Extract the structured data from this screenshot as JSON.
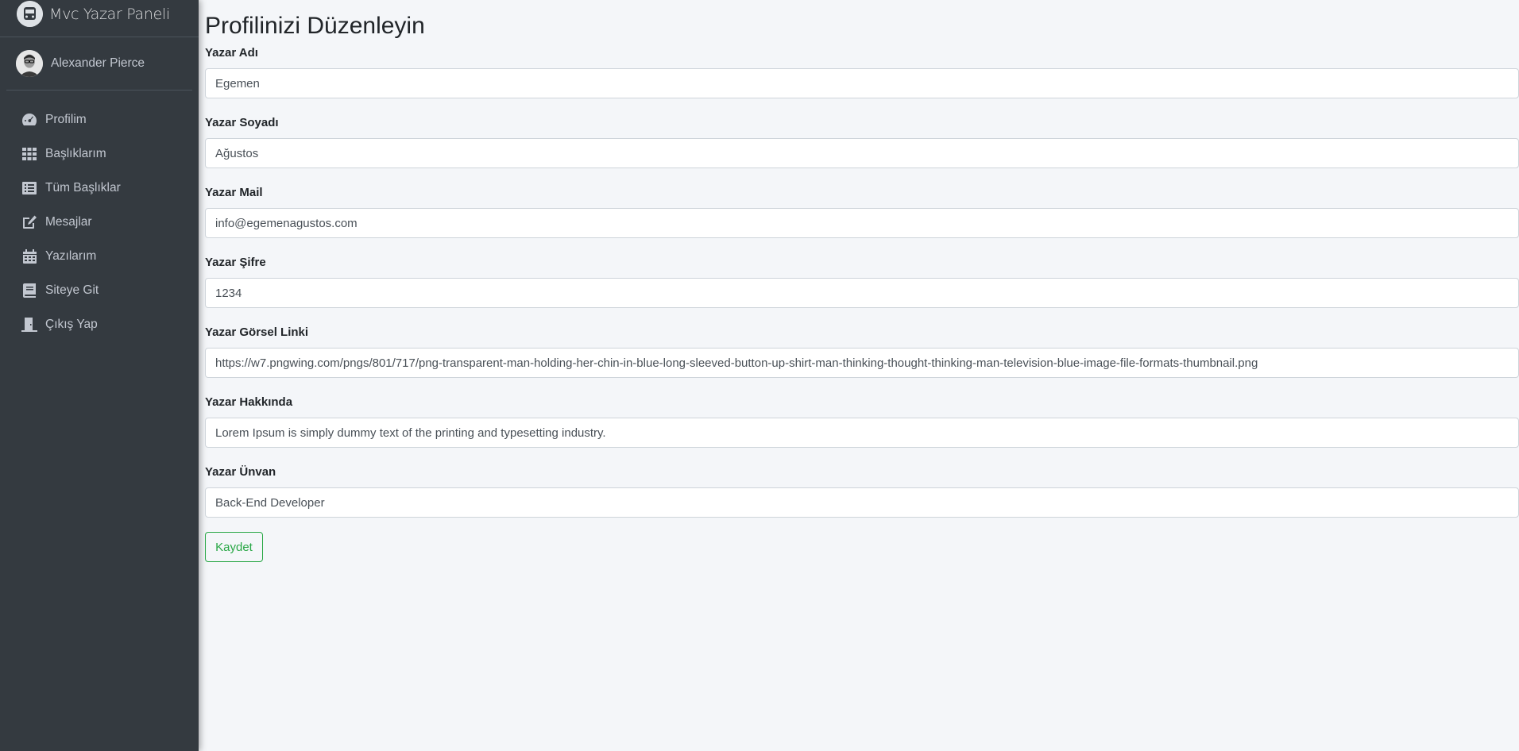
{
  "sidebar": {
    "brand": "Mvc Yazar Paneli",
    "brand_icon": "bus-logo-icon",
    "user_name": "Alexander Pierce",
    "items": [
      {
        "label": "Profilim",
        "icon": "tachometer-icon"
      },
      {
        "label": "Başlıklarım",
        "icon": "grid-icon"
      },
      {
        "label": "Tüm Başlıklar",
        "icon": "list-icon"
      },
      {
        "label": "Mesajlar",
        "icon": "edit-icon"
      },
      {
        "label": "Yazılarım",
        "icon": "calendar-icon"
      },
      {
        "label": "Siteye Git",
        "icon": "book-icon"
      },
      {
        "label": "Çıkış Yap",
        "icon": "door-icon"
      }
    ]
  },
  "page": {
    "title": "Profilinizi Düzenleyin"
  },
  "form": {
    "fields": [
      {
        "label": "Yazar Adı",
        "value": "Egemen"
      },
      {
        "label": "Yazar Soyadı",
        "value": "Ağustos"
      },
      {
        "label": "Yazar Mail",
        "value": "info@egemenagustos.com"
      },
      {
        "label": "Yazar Şifre",
        "value": "1234"
      },
      {
        "label": "Yazar Görsel Linki",
        "value": "https://w7.pngwing.com/pngs/801/717/png-transparent-man-holding-her-chin-in-blue-long-sleeved-button-up-shirt-man-thinking-thought-thinking-man-television-blue-image-file-formats-thumbnail.png"
      },
      {
        "label": "Yazar Hakkında",
        "value": "Lorem Ipsum is simply dummy text of the printing and typesetting industry."
      },
      {
        "label": "Yazar Ünvan",
        "value": "Back-End Developer"
      }
    ],
    "submit_label": "Kaydet"
  },
  "colors": {
    "sidebar_bg": "#343a40",
    "content_bg": "#f4f6f9",
    "success": "#28a745"
  }
}
